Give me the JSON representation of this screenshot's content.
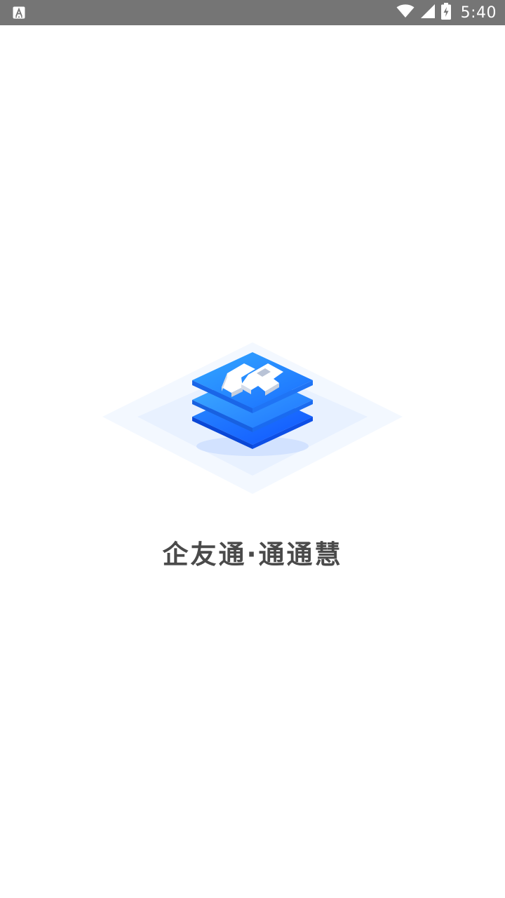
{
  "status_bar": {
    "time": "5:40",
    "icons": {
      "notification": "a-notification-icon",
      "wifi": "wifi-icon",
      "signal": "cell-signal-icon",
      "battery": "battery-charging-icon"
    }
  },
  "splash": {
    "app_name": "企友通·通通慧",
    "logo_icon": "stacked-layers-logo-icon"
  },
  "colors": {
    "status_bar_bg": "#757575",
    "text": "#4a4a4a",
    "logo_blue": "#1e78ff",
    "logo_light": "#eef4ff"
  }
}
